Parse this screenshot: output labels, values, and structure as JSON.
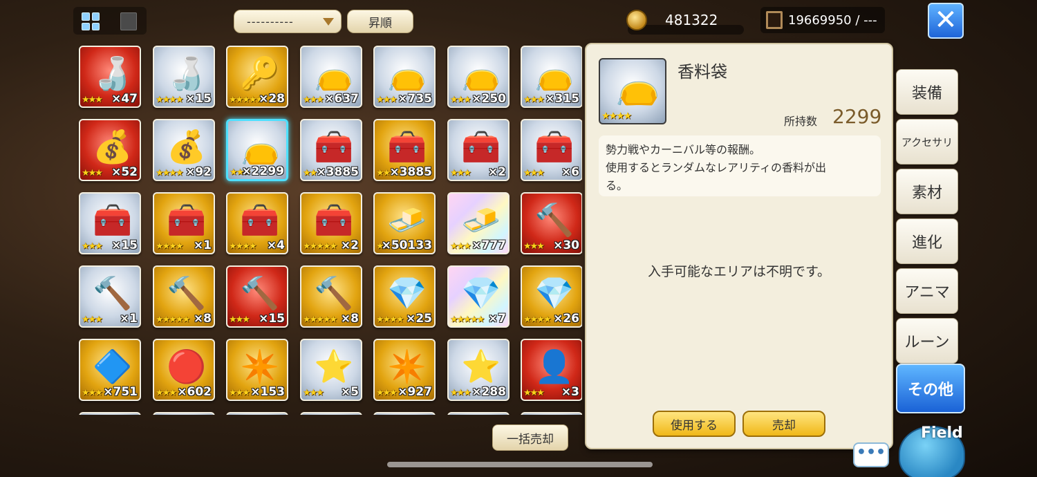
{
  "toolbar": {
    "filter_value": "----------",
    "sort_label": "昇順"
  },
  "currency": {
    "coins": "481322",
    "gems": "19669950 / ---"
  },
  "items": [
    {
      "frame": "red",
      "icon": "🍶",
      "stars": "★★★",
      "qty": "×47"
    },
    {
      "frame": "silver",
      "icon": "🍶",
      "stars": "★★★★",
      "qty": "×15"
    },
    {
      "frame": "gold",
      "icon": "🔑",
      "stars": "★★★★★",
      "qty": "×28"
    },
    {
      "frame": "silver",
      "icon": "👝",
      "stars": "★★★",
      "qty": "×637"
    },
    {
      "frame": "silver",
      "icon": "👝",
      "stars": "★★★",
      "qty": "×735"
    },
    {
      "frame": "silver",
      "icon": "👝",
      "stars": "★★★",
      "qty": "×250"
    },
    {
      "frame": "silver",
      "icon": "👝",
      "stars": "★★★",
      "qty": "×315"
    },
    {
      "frame": "red",
      "icon": "💰",
      "stars": "★★★",
      "qty": "×52"
    },
    {
      "frame": "silver",
      "icon": "💰",
      "stars": "★★★★",
      "qty": "×92"
    },
    {
      "frame": "silver",
      "icon": "👝",
      "stars": "★★★",
      "qty": "×2299",
      "selected": true
    },
    {
      "frame": "silver",
      "icon": "🧰",
      "stars": "★★",
      "qty": "×3885"
    },
    {
      "frame": "gold",
      "icon": "🧰",
      "stars": "★★",
      "qty": "×3885"
    },
    {
      "frame": "silver",
      "icon": "🧰",
      "stars": "★★★",
      "qty": "×2"
    },
    {
      "frame": "silver",
      "icon": "🧰",
      "stars": "★★★",
      "qty": "×6"
    },
    {
      "frame": "silver",
      "icon": "🧰",
      "stars": "★★★",
      "qty": "×15"
    },
    {
      "frame": "gold",
      "icon": "🧰",
      "stars": "★★★★",
      "qty": "×1"
    },
    {
      "frame": "gold",
      "icon": "🧰",
      "stars": "★★★★",
      "qty": "×4"
    },
    {
      "frame": "gold",
      "icon": "🧰",
      "stars": "★★★★★",
      "qty": "×2"
    },
    {
      "frame": "gold",
      "icon": "🧈",
      "stars": "★★",
      "qty": "×50133"
    },
    {
      "frame": "rainbow",
      "icon": "🧈",
      "stars": "★★★",
      "qty": "×777"
    },
    {
      "frame": "red",
      "icon": "🔨",
      "stars": "★★★",
      "qty": "×30"
    },
    {
      "frame": "silver",
      "icon": "🔨",
      "stars": "★★★",
      "qty": "×1"
    },
    {
      "frame": "gold",
      "icon": "🔨",
      "stars": "★★★★★",
      "qty": "×8"
    },
    {
      "frame": "red",
      "icon": "🔨",
      "stars": "★★★",
      "qty": "×15"
    },
    {
      "frame": "gold",
      "icon": "🔨",
      "stars": "★★★★★",
      "qty": "×8"
    },
    {
      "frame": "gold",
      "icon": "💎",
      "stars": "★★★★",
      "qty": "×25"
    },
    {
      "frame": "rainbow",
      "icon": "💎",
      "stars": "★★★★★",
      "qty": "×7"
    },
    {
      "frame": "gold",
      "icon": "💎",
      "stars": "★★★★",
      "qty": "×26"
    },
    {
      "frame": "gold",
      "icon": "🔷",
      "stars": "★★★",
      "qty": "×751"
    },
    {
      "frame": "gold",
      "icon": "🔴",
      "stars": "★★★",
      "qty": "×602"
    },
    {
      "frame": "gold",
      "icon": "✴️",
      "stars": "★★★",
      "qty": "×153"
    },
    {
      "frame": "silver",
      "icon": "⭐",
      "stars": "★★★",
      "qty": "×5"
    },
    {
      "frame": "gold",
      "icon": "✴️",
      "stars": "★★★",
      "qty": "×927"
    },
    {
      "frame": "silver",
      "icon": "⭐",
      "stars": "★★★",
      "qty": "×288"
    },
    {
      "frame": "red",
      "icon": "👤",
      "stars": "★★★",
      "qty": "×3"
    }
  ],
  "bulk_sell_label": "一括売却",
  "detail": {
    "icon": "👝",
    "stars": "★★★★",
    "name": "香料袋",
    "owned_label": "所持数",
    "owned_value": "2299",
    "description_line1": "勢力戦やカーニバル等の報酬。",
    "description_line2": "使用するとランダムなレアリティの香料が出",
    "description_line3": "る。",
    "area_text": "入手可能なエリアは不明です。",
    "use_label": "使用する",
    "sell_label": "売却"
  },
  "tabs": [
    {
      "label": "装備",
      "active": false
    },
    {
      "label": "アクセサリ",
      "active": false
    },
    {
      "label": "素材",
      "active": false
    },
    {
      "label": "進化",
      "active": false
    },
    {
      "label": "アニマ",
      "active": false
    },
    {
      "label": "ルーン",
      "active": false
    },
    {
      "label": "その他",
      "active": true
    }
  ],
  "chat_label": "•••",
  "field_label": "Field"
}
